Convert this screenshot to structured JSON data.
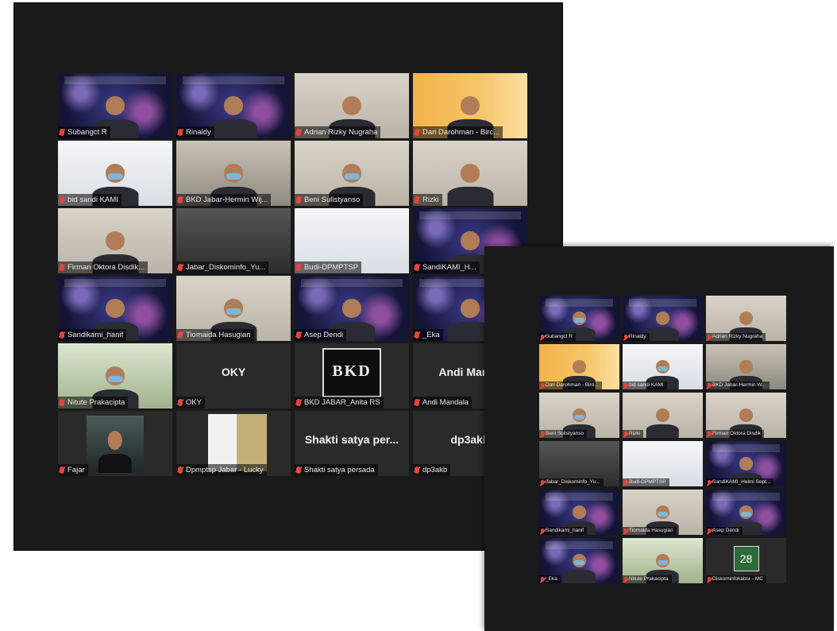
{
  "window_main": {
    "participants": [
      {
        "name": "Subangct R",
        "bg": "space",
        "avatar": true,
        "mask": false
      },
      {
        "name": "Rinaldy",
        "bg": "space",
        "avatar": true,
        "mask": false
      },
      {
        "name": "Adrian Rizky Nugraha",
        "bg": "room",
        "avatar": true,
        "mask": false
      },
      {
        "name": "Dari Darohman - Birc...",
        "bg": "orange",
        "avatar": true,
        "mask": false
      },
      {
        "name": "bid sandi KAMI",
        "bg": "slide",
        "avatar": true,
        "mask": true,
        "active": true
      },
      {
        "name": "BKD Jabar-Hermin Wij...",
        "bg": "office",
        "avatar": true,
        "mask": true
      },
      {
        "name": "Beni Sulistyanso",
        "bg": "room",
        "avatar": true,
        "mask": true
      },
      {
        "name": "Rizki",
        "bg": "room",
        "avatar": true,
        "mask": false
      },
      {
        "name": "Firman Oktora Disdik...",
        "bg": "room",
        "avatar": true,
        "mask": false
      },
      {
        "name": "Jabar_Diskominfo_Yu...",
        "bg": "hall",
        "avatar": false
      },
      {
        "name": "Budi-DPMPTSP",
        "bg": "slide",
        "avatar": false
      },
      {
        "name": "SandiKAMI_H...",
        "bg": "space",
        "avatar": true,
        "mask": false
      },
      {
        "name": "Sandikami_hanif",
        "bg": "space",
        "avatar": true,
        "mask": false
      },
      {
        "name": "Tiomaida Hasugian",
        "bg": "room",
        "avatar": true,
        "mask": true
      },
      {
        "name": "Asep Dendi",
        "bg": "space",
        "avatar": true,
        "mask": false
      },
      {
        "name": "_Eka",
        "bg": "space",
        "avatar": true,
        "mask": false
      },
      {
        "name": "Nitute Prakacipta",
        "bg": "green",
        "avatar": true,
        "mask": true
      },
      {
        "name": "OKY",
        "bg": "dark",
        "label": "OKY"
      },
      {
        "name": "BKD JABAR_Anita RS",
        "bg": "dark",
        "logo": "BKD"
      },
      {
        "name": "Andi Mandala",
        "bg": "dark",
        "label": "Andi Manda"
      },
      {
        "name": "Fajar",
        "bg": "dark",
        "portrait": true
      },
      {
        "name": "Dpmptsp Jabar - Lucky",
        "bg": "dark",
        "poster": true
      },
      {
        "name": "Shakti satya persada",
        "bg": "dark",
        "label": "Shakti satya per..."
      },
      {
        "name": "dp3akb",
        "bg": "dark",
        "label": "dp3akb"
      }
    ]
  },
  "window_second": {
    "participants": [
      {
        "name": "Subangct R",
        "bg": "space",
        "avatar": true,
        "mask": true
      },
      {
        "name": "Rinaldy",
        "bg": "space",
        "avatar": true,
        "mask": false
      },
      {
        "name": "Adrian Rizky Nugraha",
        "bg": "room",
        "avatar": true,
        "mask": false
      },
      {
        "name": "Dari Darohman - Biro...",
        "bg": "orange",
        "avatar": true,
        "mask": false
      },
      {
        "name": "bid sandi KAMI",
        "bg": "slide",
        "avatar": true,
        "mask": true,
        "active": true
      },
      {
        "name": "BKD Jabar-Hermin W...",
        "bg": "office",
        "avatar": true,
        "mask": false
      },
      {
        "name": "Beni Sulistyanso",
        "bg": "room",
        "avatar": true,
        "mask": true
      },
      {
        "name": "Rizki",
        "bg": "room",
        "avatar": true,
        "mask": false
      },
      {
        "name": "Firman Oktora Disdik",
        "bg": "room",
        "avatar": true,
        "mask": false
      },
      {
        "name": "Jabar_Diskominfo_Yu...",
        "bg": "hall",
        "avatar": false
      },
      {
        "name": "Budi-DPMPTSP",
        "bg": "slide",
        "avatar": false
      },
      {
        "name": "SandiKAMI_Helmi Sept...",
        "bg": "space",
        "avatar": true,
        "mask": false
      },
      {
        "name": "Sandikami_hanif",
        "bg": "space",
        "avatar": true,
        "mask": false
      },
      {
        "name": "Tiomaida Hasugian",
        "bg": "room",
        "avatar": true,
        "mask": true
      },
      {
        "name": "Asep Dendi",
        "bg": "space",
        "avatar": true,
        "mask": true
      },
      {
        "name": "_Eka",
        "bg": "space",
        "avatar": true,
        "mask": true
      },
      {
        "name": "Nitute Prakacipta",
        "bg": "green",
        "avatar": true,
        "mask": true
      },
      {
        "name": "Diskominfokabsr - MC",
        "bg": "dark",
        "shield": "28"
      }
    ]
  }
}
